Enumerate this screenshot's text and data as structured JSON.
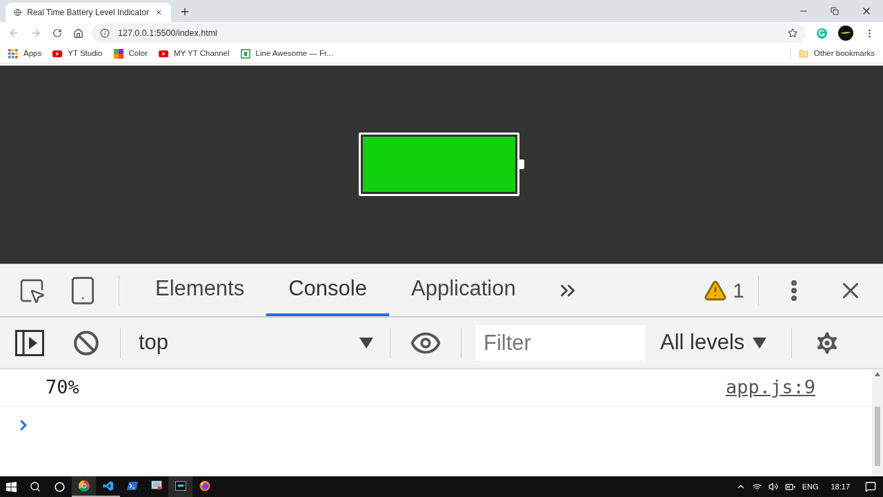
{
  "browser": {
    "tab": {
      "title": "Real Time Battery Level Indicator"
    },
    "address": "127.0.0.1:5500/index.html",
    "bookmarks": [
      {
        "label": "Apps",
        "kind": "apps"
      },
      {
        "label": "YT Studio",
        "kind": "youtube"
      },
      {
        "label": "Color",
        "kind": "color"
      },
      {
        "label": "MY YT Channel",
        "kind": "youtube"
      },
      {
        "label": "Line Awesome — Fr...",
        "kind": "line"
      }
    ],
    "other_bookmarks": "Other bookmarks"
  },
  "page": {
    "battery": {
      "level": 1
    }
  },
  "devtools": {
    "tabs": [
      {
        "label": "Elements",
        "selected": false
      },
      {
        "label": "Console",
        "selected": true
      },
      {
        "label": "Application",
        "selected": false
      }
    ],
    "warning_count": "1",
    "context": "top",
    "filter_placeholder": "Filter",
    "levels": "All levels",
    "messages": [
      {
        "text": "70%",
        "source": "app.js:9"
      }
    ]
  },
  "taskbar": {
    "apps": [
      {
        "kind": "chrome",
        "open": true,
        "active": true
      },
      {
        "kind": "vscode",
        "open": true,
        "active": false
      },
      {
        "kind": "powershell",
        "open": false,
        "active": false
      },
      {
        "kind": "remote",
        "open": false,
        "active": false
      },
      {
        "kind": "terminal",
        "open": false,
        "active": true
      },
      {
        "kind": "firefox",
        "open": false,
        "active": false
      }
    ],
    "language": "ENG",
    "time": "18:17"
  }
}
